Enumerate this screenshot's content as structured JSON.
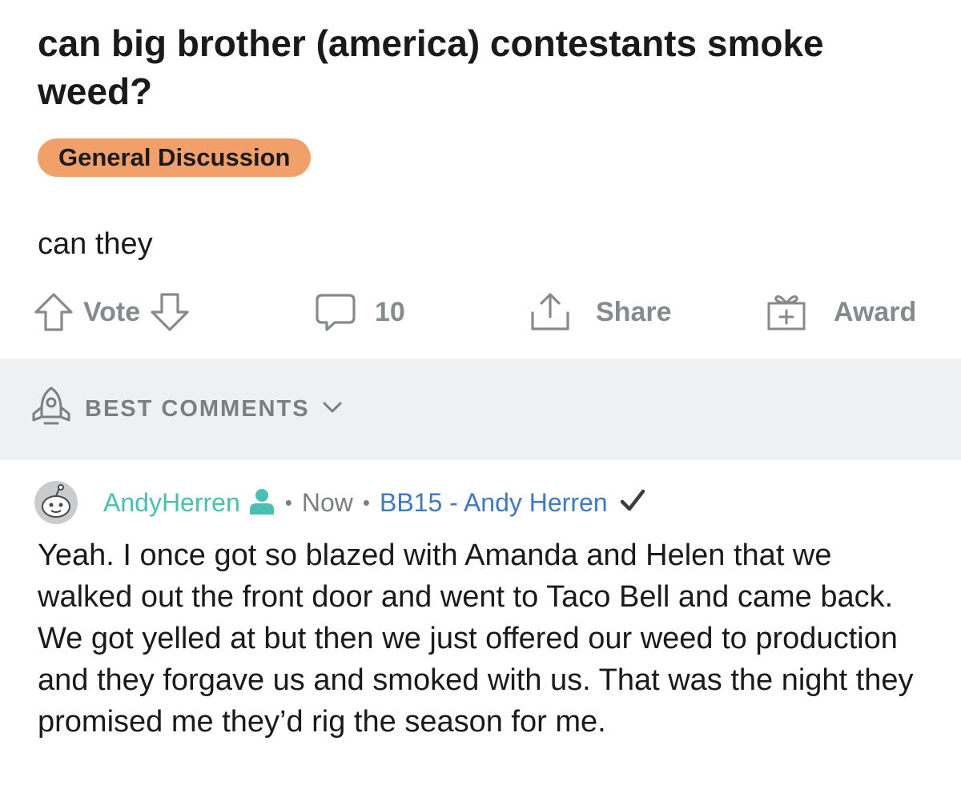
{
  "post": {
    "title": "can big brother (america) contestants smoke weed?",
    "flair": "General Discussion",
    "body": "can they",
    "flair_color": "#f0a068"
  },
  "actions": {
    "vote_label": "Vote",
    "comments_count": "10",
    "share_label": "Share",
    "award_label": "Award",
    "icons": [
      "upvote-arrow-icon",
      "downvote-arrow-icon",
      "comment-bubble-icon",
      "share-icon",
      "gift-icon"
    ]
  },
  "sort": {
    "label": "BEST COMMENTS",
    "icon": "rocket-icon"
  },
  "comment": {
    "username": "AndyHerren",
    "time": "Now",
    "user_flair": "BB15 - Andy Herren",
    "body": "Yeah. I once got so blazed with Amanda and Helen that we walked out the front door and went to Taco Bell and came back. We got yelled at but then we just offered our weed to production and they forgave us and smoked with us. That was the night they promised me they’d rig the season for me.",
    "username_color": "#46c1b1",
    "flair_color": "#3d79c4"
  }
}
